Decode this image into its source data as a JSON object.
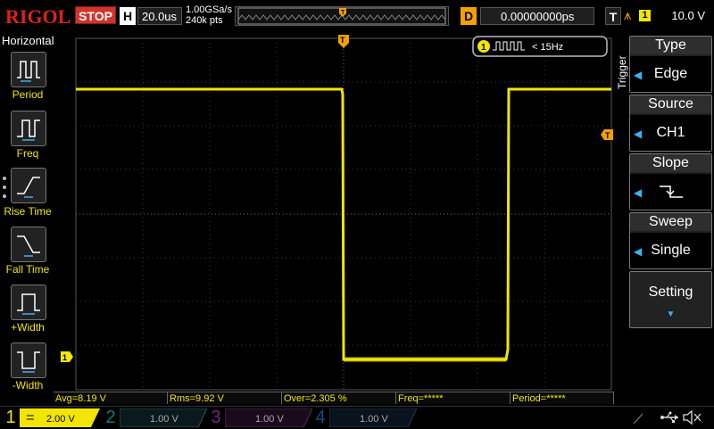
{
  "header": {
    "brand": "RIGOL",
    "run_state": "STOP",
    "horizontal_key": "H",
    "timebase": "20.0us",
    "sample_rate": "1.00GSa/s",
    "memory_depth": "240k pts",
    "delay_key": "D",
    "delay_value": "0.00000000ps",
    "trigger_key": "T",
    "trigger_channel": "1",
    "trigger_level": "10.0 V"
  },
  "left_panel": {
    "title": "Horizontal",
    "items": [
      {
        "label": "Period",
        "icon": "period-icon"
      },
      {
        "label": "Freq",
        "icon": "freq-icon"
      },
      {
        "label": "Rise Time",
        "icon": "rise-time-icon"
      },
      {
        "label": "Fall Time",
        "icon": "fall-time-icon"
      },
      {
        "label": "+Width",
        "icon": "positive-width-icon"
      },
      {
        "label": "-Width",
        "icon": "negative-width-icon"
      }
    ]
  },
  "waveform": {
    "channel_badge": "1",
    "frequency_readout": "< 15Hz",
    "trigger_marker": "T",
    "channel_marker": "1"
  },
  "right_panel": {
    "section_label": "Trigger",
    "menus": [
      {
        "title": "Type",
        "value": "Edge"
      },
      {
        "title": "Source",
        "value": "CH1"
      },
      {
        "title": "Slope",
        "value": "falling-edge-icon"
      },
      {
        "title": "Sweep",
        "value": "Single"
      }
    ],
    "setting_label": "Setting"
  },
  "measurements": [
    {
      "label": "Avg=8.19 V"
    },
    {
      "label": "Rms=9.92 V"
    },
    {
      "label": "Over=2.305 %"
    },
    {
      "label": "Freq=*****"
    },
    {
      "label": "Period=*****"
    }
  ],
  "channels": [
    {
      "number": "1",
      "scale": "2.00 V",
      "color": "#f2e600",
      "active": true
    },
    {
      "number": "2",
      "scale": "1.00 V",
      "color": "#1ec8d6",
      "active": false
    },
    {
      "number": "3",
      "scale": "1.00 V",
      "color": "#c23fd0",
      "active": false
    },
    {
      "number": "4",
      "scale": "1.00 V",
      "color": "#1e7ed6",
      "active": false
    }
  ],
  "colors": {
    "ch1": "#f2e600",
    "trigger": "#f2a100",
    "brand": "#e0211b",
    "stop": "#d0342c",
    "menu_arrow": "#3ab1f0"
  }
}
